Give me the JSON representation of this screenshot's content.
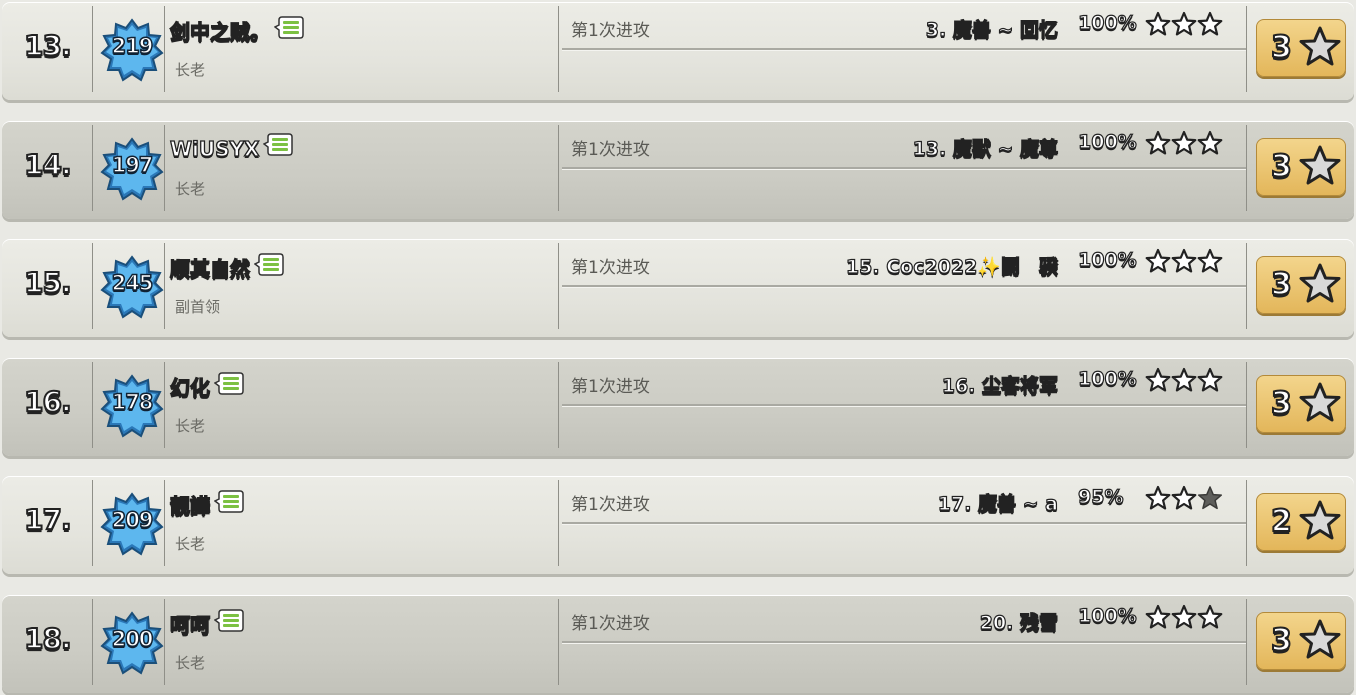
{
  "rows": [
    {
      "rank": "13.",
      "level": "219",
      "name": "剑中之贼。",
      "role": "长老",
      "attack_label": "第1次进攻",
      "target": "3. 魔兽 ~ 回忆",
      "percent": "100%",
      "stars_earned": 3,
      "score": "3"
    },
    {
      "rank": "14.",
      "level": "197",
      "name": "WiUSYX",
      "role": "长老",
      "attack_label": "第1次进攻",
      "target": "13. 魔獸 ~ 魔尊",
      "percent": "100%",
      "stars_earned": 3,
      "score": "3"
    },
    {
      "rank": "15.",
      "level": "245",
      "name": "顺其自然",
      "role": "副首领",
      "attack_label": "第1次进攻",
      "target": "15. Coc2022✨鬭　骙",
      "percent": "100%",
      "stars_earned": 3,
      "score": "3"
    },
    {
      "rank": "16.",
      "level": "178",
      "name": "幻化",
      "role": "长老",
      "attack_label": "第1次进攻",
      "target": "16. 尘客将军",
      "percent": "100%",
      "stars_earned": 3,
      "score": "3"
    },
    {
      "rank": "17.",
      "level": "209",
      "name": "靓譁",
      "role": "长老",
      "attack_label": "第1次进攻",
      "target": "17. 魔兽 ~ a",
      "percent": "95%",
      "stars_earned": 2,
      "score": "2"
    },
    {
      "rank": "18.",
      "level": "200",
      "name": "呵呵",
      "role": "长老",
      "attack_label": "第1次进攻",
      "target": "20. 残雪",
      "percent": "100%",
      "stars_earned": 3,
      "score": "3"
    }
  ],
  "icons": {
    "badge": "xp-level-star-badge-icon",
    "chat": "chat-message-icon",
    "star_empty": "star-outline-icon",
    "star_filled": "star-filled-icon",
    "score_star": "score-star-icon"
  },
  "colors": {
    "score_box": "#e3b65a",
    "badge_blue": "#4aa3e0",
    "chat_green": "#7cc142"
  }
}
